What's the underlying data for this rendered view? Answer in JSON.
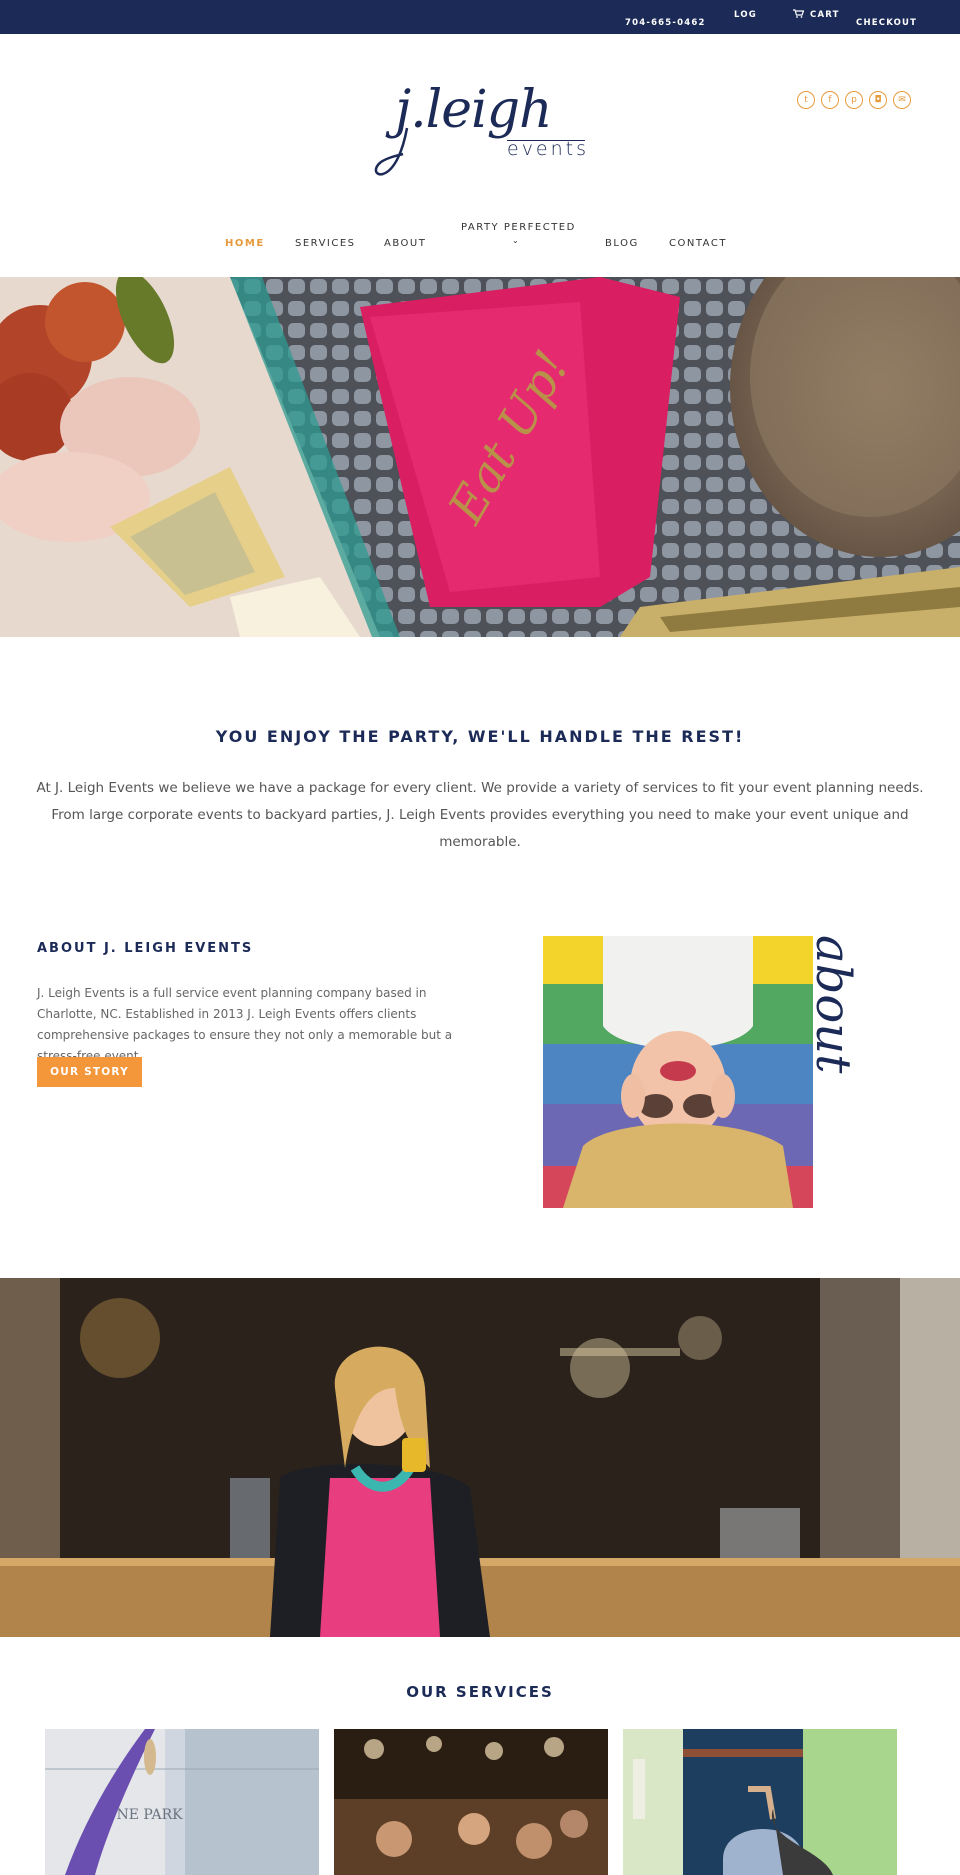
{
  "topbar": {
    "phone": "704-665-0462",
    "log": "LOG",
    "cart_icon": "cart-icon",
    "cart": "CART",
    "checkout": "CHECKOUT"
  },
  "logo": {
    "main": "j.leigh",
    "sub": "events"
  },
  "social": [
    {
      "icon": "twitter-icon",
      "glyph": "t"
    },
    {
      "icon": "facebook-icon",
      "glyph": "f"
    },
    {
      "icon": "pinterest-icon",
      "glyph": "p"
    },
    {
      "icon": "instagram-icon",
      "glyph": "◘"
    },
    {
      "icon": "email-icon",
      "glyph": "✉"
    }
  ],
  "nav": {
    "home": "HOME",
    "services": "SERVICES",
    "about": "ABOUT",
    "party": "PARTY PERFECTED",
    "party_caret": "⌄",
    "blog": "BLOG",
    "contact": "CONTACT"
  },
  "hero": {
    "napkin_text": "Eat Up!",
    "slides": 3,
    "active_slide": 1
  },
  "intro": {
    "heading": "YOU ENJOY THE PARTY, WE'LL HANDLE THE REST!",
    "text": "At J. Leigh Events we believe we have a package for every client. We provide a variety of services to fit your event planning needs. From large corporate events to backyard parties, J. Leigh Events provides everything you need to make your event unique and memorable."
  },
  "about": {
    "heading": "ABOUT J. LEIGH EVENTS",
    "text": "J. Leigh Events is a full service event planning company based in Charlotte, NC. Established in 2013 J. Leigh Events offers clients comprehensive packages to ensure they not only a memorable but a stress-free event.",
    "button": "OUR STORY",
    "script_word": "about"
  },
  "services": {
    "heading": "OUR SERVICES",
    "card1_sign": "ONE PARK"
  },
  "colors": {
    "navy": "#1b2a56",
    "orange": "#f4973a",
    "accent_orange": "#e69a3c"
  }
}
